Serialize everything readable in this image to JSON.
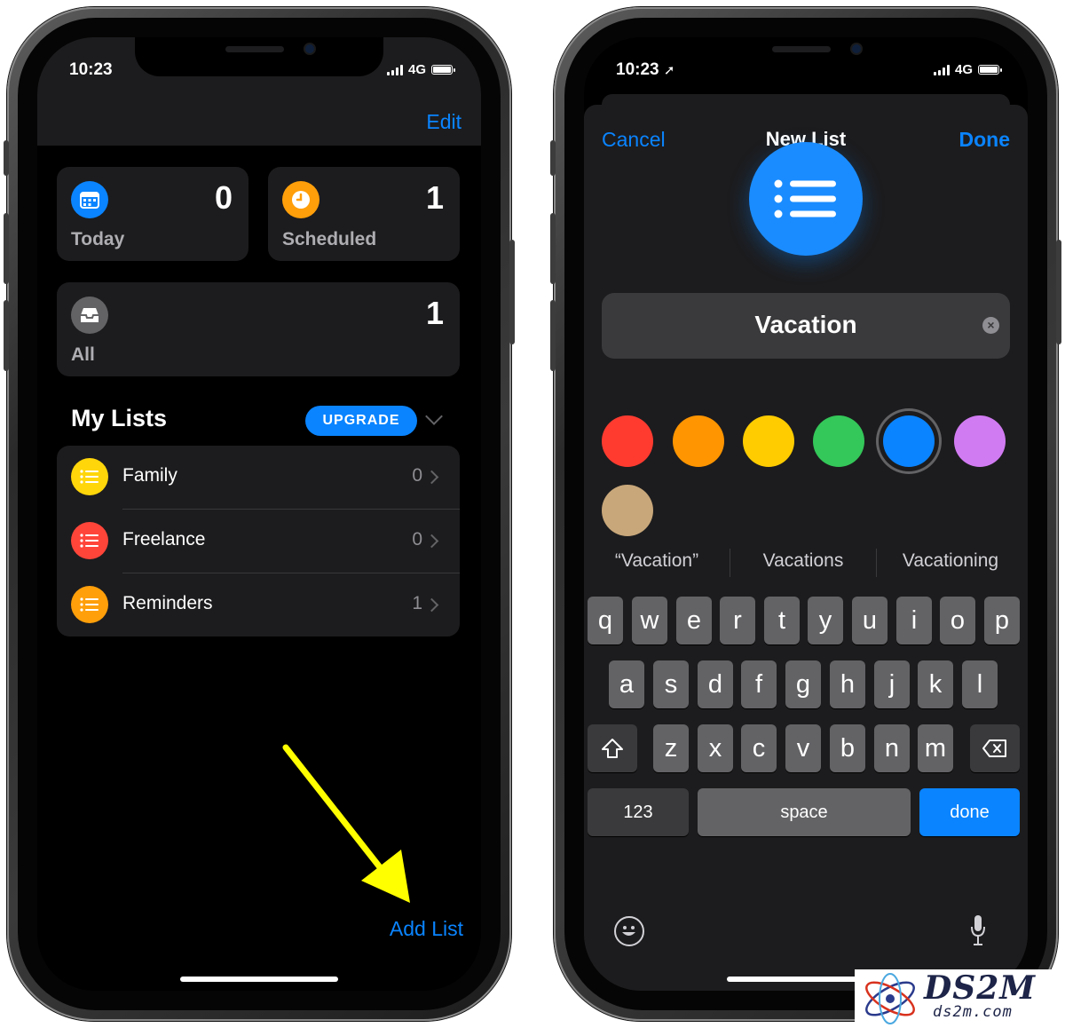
{
  "left": {
    "status": {
      "time": "10:23",
      "network": "4G"
    },
    "edit_label": "Edit",
    "cards": {
      "today": {
        "label": "Today",
        "count": "0",
        "color": "#0a84ff",
        "icon": "calendar-icon"
      },
      "scheduled": {
        "label": "Scheduled",
        "count": "1",
        "color": "#ff9f0a",
        "icon": "clock-icon"
      },
      "all": {
        "label": "All",
        "count": "1",
        "color": "#636366",
        "icon": "tray-icon"
      }
    },
    "my_lists_title": "My Lists",
    "upgrade_label": "UPGRADE",
    "lists": [
      {
        "name": "Family",
        "count": "0",
        "color": "#ffd60a"
      },
      {
        "name": "Freelance",
        "count": "0",
        "color": "#ff453a"
      },
      {
        "name": "Reminders",
        "count": "1",
        "color": "#ff9f0a"
      }
    ],
    "add_list_label": "Add List"
  },
  "right": {
    "status": {
      "time": "10:23",
      "network": "4G"
    },
    "nav": {
      "cancel": "Cancel",
      "title": "New List",
      "done": "Done"
    },
    "list_name_value": "Vacation",
    "colors": [
      "#ff3b30",
      "#ff9500",
      "#ffcc00",
      "#34c759",
      "#0a84ff",
      "#d17bf2",
      "#c8a77a"
    ],
    "selected_color_index": 4,
    "suggestions": [
      "“Vacation”",
      "Vacations",
      "Vacationing"
    ],
    "keyboard": {
      "row1": [
        "q",
        "w",
        "e",
        "r",
        "t",
        "y",
        "u",
        "i",
        "o",
        "p"
      ],
      "row2": [
        "a",
        "s",
        "d",
        "f",
        "g",
        "h",
        "j",
        "k",
        "l"
      ],
      "row3": [
        "z",
        "x",
        "c",
        "v",
        "b",
        "n",
        "m"
      ],
      "numbers": "123",
      "space": "space",
      "done": "done"
    }
  },
  "watermark": {
    "brand": "DS2M",
    "site": "ds2m.com"
  }
}
